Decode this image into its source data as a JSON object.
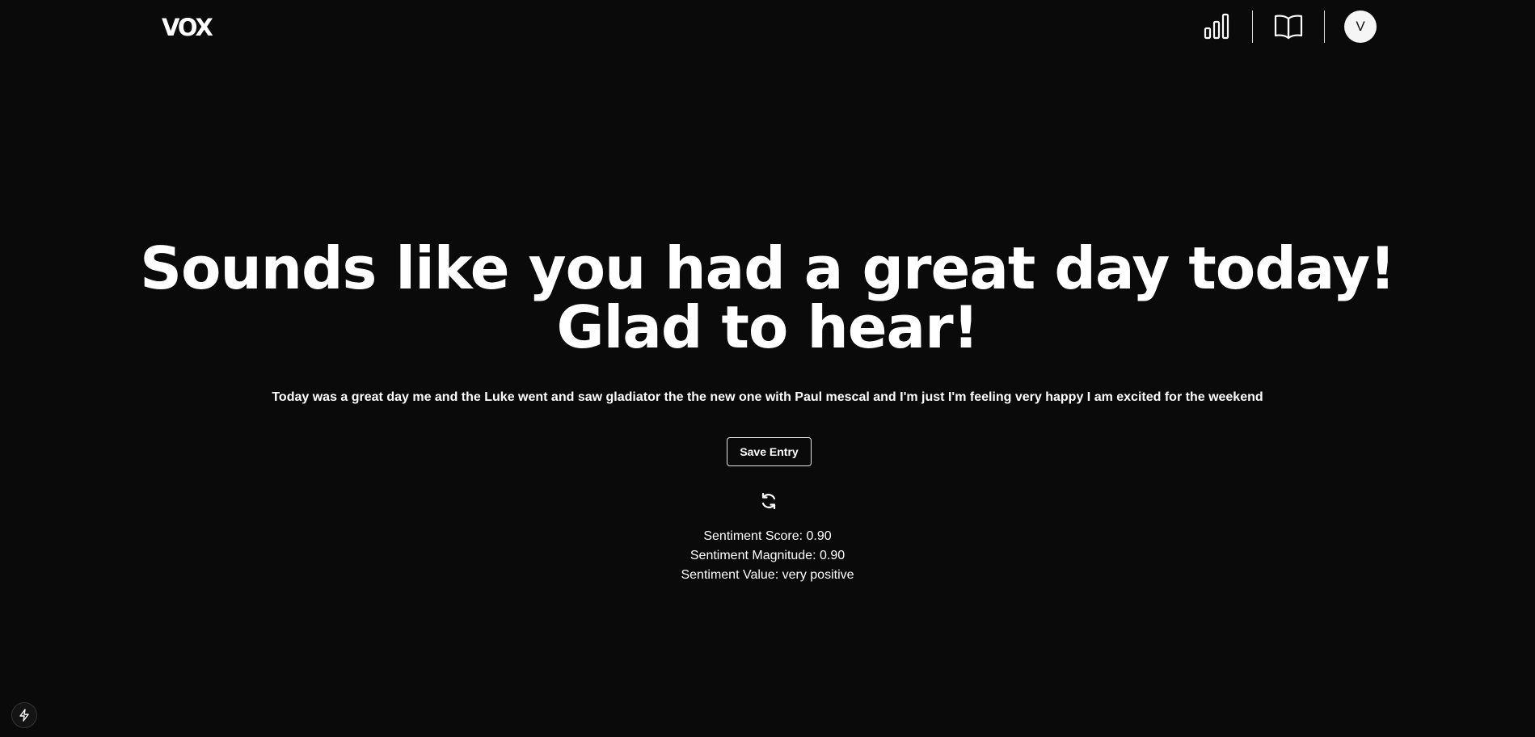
{
  "header": {
    "logo": "VOX",
    "nav": {
      "stats_icon": "bar-chart-icon",
      "journal_icon": "book-open-icon",
      "avatar_initial": "V"
    }
  },
  "main": {
    "headline": "Sounds like you had a great day today! Glad to hear!",
    "transcript": "Today was a great day me and the Luke went and saw gladiator the the new one with Paul mescal and I'm just I'm feeling very happy I am excited for the weekend",
    "save_label": "Save Entry",
    "refresh_icon": "refresh-icon",
    "sentiment": {
      "score": "Sentiment Score: 0.90",
      "magnitude": "Sentiment Magnitude: 0.90",
      "value": "Sentiment Value: very positive"
    }
  },
  "dev_indicator_icon": "lightning-icon",
  "colors": {
    "background": "#0a0a0a",
    "text": "#ffffff",
    "avatar_bg": "#f5f5f5"
  }
}
